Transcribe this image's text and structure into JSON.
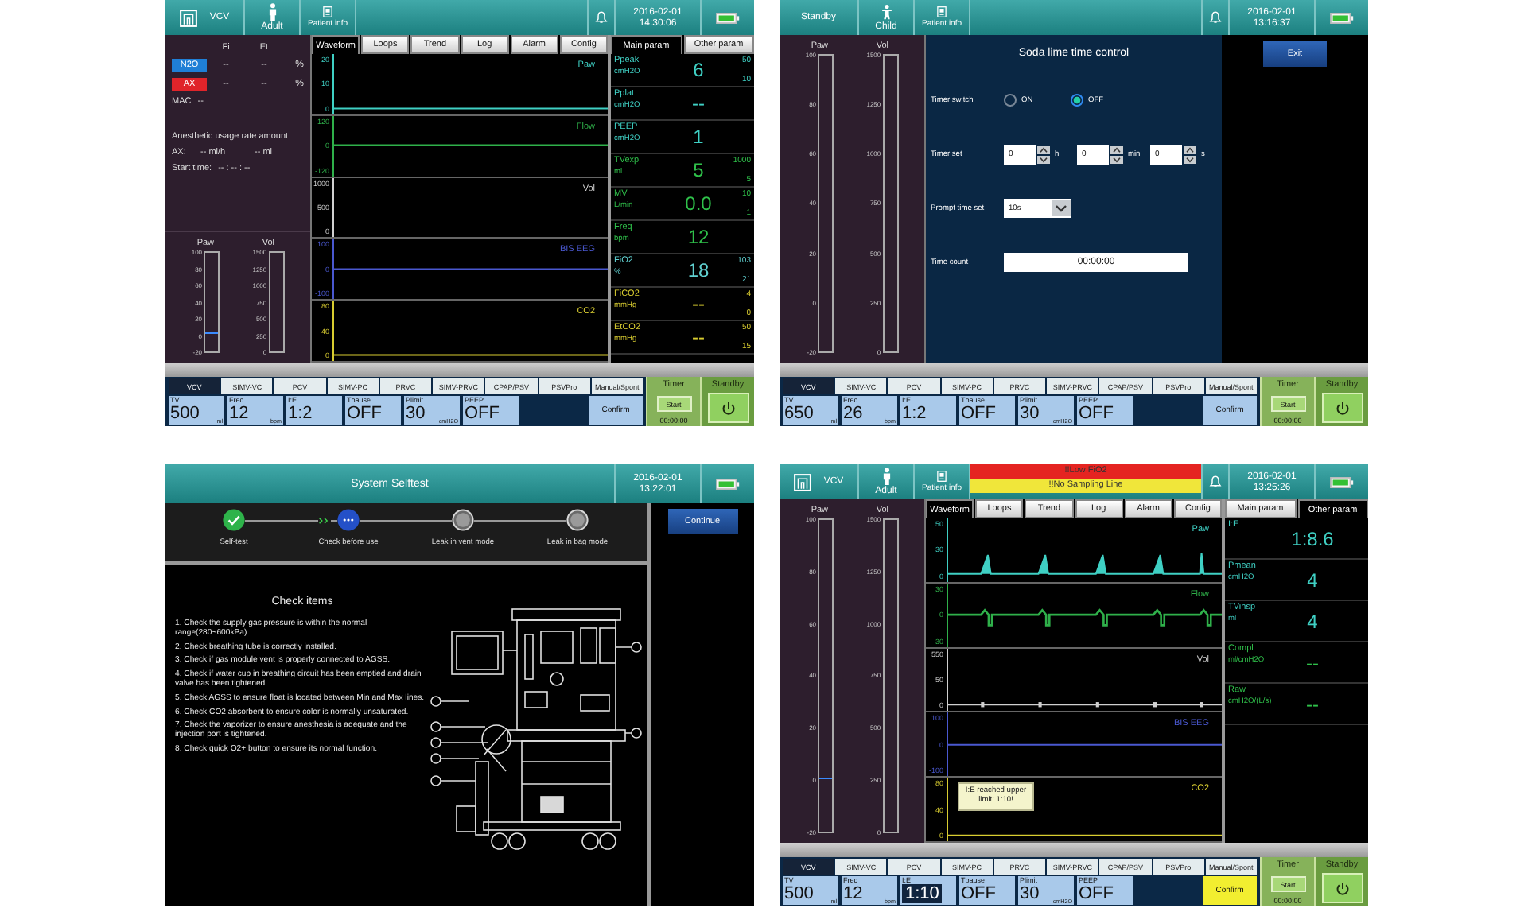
{
  "panels": [
    {
      "kind": "monitor",
      "header": {
        "mode": "VCV",
        "mode_icon": true,
        "patient": {
          "label": "Adult",
          "kind": "adult"
        },
        "patient_info": "Patient info",
        "date": "2016-02-01",
        "time": "14:30:06"
      },
      "gas": {
        "columns": [
          "Fi",
          "Et"
        ],
        "agents": [
          {
            "name": "N2O",
            "color": "#1f7fd6",
            "fi": "--",
            "et": "--",
            "unit": "%"
          },
          {
            "name": "AX",
            "color": "#e0242a",
            "fi": "--",
            "et": "--",
            "unit": "%"
          }
        ],
        "mac": {
          "label": "MAC",
          "value": "--"
        },
        "usage_title": "Anesthetic usage rate amount",
        "usage": {
          "agent": "AX:",
          "rate": "-- ml/h",
          "amount": "-- ml"
        },
        "start_time": {
          "label": "Start time:",
          "value": "-- : -- : --"
        }
      },
      "gauges": [
        {
          "label": "Paw",
          "ticks": [
            "100",
            "80",
            "60",
            "40",
            "20",
            "0",
            "-20"
          ],
          "level": 0.17
        },
        {
          "label": "Vol",
          "ticks": [
            "1500",
            "1250",
            "1000",
            "750",
            "500",
            "250",
            "0"
          ]
        }
      ],
      "wave_tabs": [
        {
          "label": "Waveform",
          "selected": true
        },
        {
          "label": "Loops",
          "selected": false
        },
        {
          "label": "Trend",
          "selected": false
        },
        {
          "label": "Log",
          "selected": false
        },
        {
          "label": "Alarm",
          "selected": false
        },
        {
          "label": "Config",
          "selected": false
        }
      ],
      "waves": [
        {
          "label": "Paw",
          "color": "#3fd0c4",
          "ticks": [
            "20",
            "10",
            "0"
          ],
          "kind": "flat_low"
        },
        {
          "label": "Flow",
          "color": "#2fb04a",
          "ticks": [
            "120",
            "0",
            "-120"
          ],
          "kind": "flat_mid"
        },
        {
          "label": "Vol",
          "color": "#d0d0d0",
          "ticks": [
            "1000",
            "500",
            "0"
          ],
          "kind": "none"
        },
        {
          "label": "BIS EEG",
          "color": "#4a58d0",
          "ticks": [
            "100",
            "0",
            "-100"
          ],
          "kind": "flat_mid"
        },
        {
          "label": "CO2",
          "color": "#d8cc30",
          "ticks": [
            "80",
            "40",
            "0"
          ],
          "kind": "flat_low"
        }
      ],
      "param_tabs": [
        {
          "label": "Main param",
          "selected": true
        },
        {
          "label": "Other param",
          "selected": false
        }
      ],
      "params": [
        {
          "name": "Ppeak",
          "unit": "cmH2O",
          "value": "6",
          "high": "50",
          "low": "10",
          "color": "#3fd0c4"
        },
        {
          "name": "Pplat",
          "unit": "cmH2O",
          "value": "--",
          "color": "#3fd0c4"
        },
        {
          "name": "PEEP",
          "unit": "cmH2O",
          "value": "1",
          "color": "#3fd0c4"
        },
        {
          "name": "TVexp",
          "unit": "ml",
          "value": "5",
          "high": "1000",
          "low": "5",
          "color": "#2fc04a"
        },
        {
          "name": "MV",
          "unit": "L/min",
          "value": "0.0",
          "high": "10",
          "low": "1",
          "color": "#2fc04a"
        },
        {
          "name": "Freq",
          "unit": "bpm",
          "value": "12",
          "color": "#2fc04a"
        },
        {
          "name": "FiO2",
          "unit": "%",
          "value": "18",
          "high": "103",
          "low": "21",
          "color": "#60d0d0"
        },
        {
          "name": "FiCO2",
          "unit": "mmHg",
          "value": "--",
          "high": "4",
          "low": "0",
          "color": "#d8cc30"
        },
        {
          "name": "EtCO2",
          "unit": "mmHg",
          "value": "--",
          "high": "50",
          "low": "15",
          "color": "#d8cc30"
        }
      ],
      "modes": [
        {
          "label": "VCV",
          "selected": true
        },
        {
          "label": "SIMV-VC",
          "selected": false
        },
        {
          "label": "PCV",
          "selected": false
        },
        {
          "label": "SIMV-PC",
          "selected": false
        },
        {
          "label": "PRVC",
          "selected": false
        },
        {
          "label": "SIMV-PRVC",
          "selected": false
        },
        {
          "label": "CPAP/PSV",
          "selected": false
        },
        {
          "label": "PSVPro",
          "selected": false
        },
        {
          "label": "Manual/Spont",
          "selected": false
        }
      ],
      "settings": [
        {
          "label": "TV",
          "value": "500",
          "unit": "ml",
          "selected": false
        },
        {
          "label": "Freq",
          "value": "12",
          "unit": "bpm",
          "selected": false
        },
        {
          "label": "I:E",
          "value": "1:2",
          "selected": false
        },
        {
          "label": "Tpause",
          "value": "OFF",
          "selected": false
        },
        {
          "label": "Plimit",
          "value": "30",
          "unit": "cmH2O",
          "selected": false
        },
        {
          "label": "PEEP",
          "value": "OFF",
          "selected": false
        }
      ],
      "confirm": {
        "label": "Confirm",
        "highlighted": false
      },
      "timer": {
        "title": "Timer",
        "button": "Start",
        "time": "00:00:00"
      },
      "standby": {
        "title": "Standby"
      }
    },
    {
      "kind": "soda_lime",
      "header": {
        "mode": "Standby",
        "mode_icon": false,
        "patient": {
          "label": "Child",
          "kind": "child"
        },
        "patient_info": "Patient info",
        "date": "2016-02-01",
        "time": "13:16:37"
      },
      "gauges": [
        {
          "label": "Paw",
          "ticks": [
            "100",
            "80",
            "60",
            "40",
            "20",
            "0",
            "-20"
          ]
        },
        {
          "label": "Vol",
          "ticks": [
            "1500",
            "1250",
            "1000",
            "750",
            "500",
            "250",
            "0"
          ]
        }
      ],
      "form": {
        "title": "Soda lime time control",
        "switch_label": "Timer switch",
        "switch_options": [
          {
            "label": "ON",
            "selected": false
          },
          {
            "label": "OFF",
            "selected": true
          }
        ],
        "timer_label": "Timer set",
        "timer_fields": [
          {
            "value": "0",
            "unit": "h"
          },
          {
            "value": "0",
            "unit": "min"
          },
          {
            "value": "0",
            "unit": "s"
          }
        ],
        "prompt_label": "Prompt time set",
        "prompt_value": "10s",
        "count_label": "Time count",
        "count_value": "00:00:00"
      },
      "exit": "Exit",
      "modes": [
        {
          "label": "VCV",
          "selected": true
        },
        {
          "label": "SIMV-VC",
          "selected": false
        },
        {
          "label": "PCV",
          "selected": false
        },
        {
          "label": "SIMV-PC",
          "selected": false
        },
        {
          "label": "PRVC",
          "selected": false
        },
        {
          "label": "SIMV-PRVC",
          "selected": false
        },
        {
          "label": "CPAP/PSV",
          "selected": false
        },
        {
          "label": "PSVPro",
          "selected": false
        },
        {
          "label": "Manual/Spont",
          "selected": false
        }
      ],
      "settings": [
        {
          "label": "TV",
          "value": "650",
          "unit": "ml",
          "selected": false
        },
        {
          "label": "Freq",
          "value": "26",
          "unit": "bpm",
          "selected": false
        },
        {
          "label": "I:E",
          "value": "1:2",
          "selected": false
        },
        {
          "label": "Tpause",
          "value": "OFF",
          "selected": false
        },
        {
          "label": "Plimit",
          "value": "30",
          "unit": "cmH2O",
          "selected": false
        },
        {
          "label": "PEEP",
          "value": "OFF",
          "selected": false
        }
      ],
      "confirm": {
        "label": "Confirm",
        "highlighted": false
      },
      "timer": {
        "title": "Timer",
        "button": "Start",
        "time": "00:00:00"
      },
      "standby": {
        "title": "Standby"
      }
    },
    {
      "kind": "selftest",
      "header": {
        "title": "System Selftest",
        "date": "2016-02-01",
        "time": "13:22:01"
      },
      "steps": [
        {
          "label": "Self-test",
          "kind": "done"
        },
        {
          "label": "Check before use",
          "kind": "current"
        },
        {
          "label": "Leak in vent mode",
          "kind": "pending"
        },
        {
          "label": "Leak in bag mode",
          "kind": "pending"
        }
      ],
      "continue": "Continue",
      "checklist_title": "Check items",
      "checklist": [
        "1. Check the supply gas pressure is within the normal range(280~600kPa).",
        "2. Check breathing tube is correctly installed.",
        "3. Check if gas module vent is properly connected to AGSS.",
        "4. Check if water cup in breathing circuit has been emptied and drain valve has been tightened.",
        "5. Check AGSS to ensure float is located between Min and Max lines.",
        "6. Check CO2 absorbent to ensure color is normally unsaturated.",
        "7. Check the vaporizer to ensure anesthesia is adequate and the injection port is tightened.",
        "8. Check quick O2+ button to ensure its normal function."
      ]
    },
    {
      "kind": "monitor",
      "header": {
        "mode": "VCV",
        "mode_icon": true,
        "patient": {
          "label": "Adult",
          "kind": "adult"
        },
        "patient_info": "Patient info",
        "alarms": [
          {
            "text": "!!Low FiO2",
            "color": "#e52421"
          },
          {
            "text": "!!No Sampling Line",
            "color": "#f0e63a"
          }
        ],
        "date": "2016-02-01",
        "time": "13:25:26"
      },
      "gauges": [
        {
          "label": "Paw",
          "ticks": [
            "100",
            "80",
            "60",
            "40",
            "20",
            "0",
            "-20"
          ],
          "level": 0.17
        },
        {
          "label": "Vol",
          "ticks": [
            "1500",
            "1250",
            "1000",
            "750",
            "500",
            "250",
            "0"
          ]
        }
      ],
      "wave_tabs": [
        {
          "label": "Waveform",
          "selected": true
        },
        {
          "label": "Loops",
          "selected": false
        },
        {
          "label": "Trend",
          "selected": false
        },
        {
          "label": "Log",
          "selected": false
        },
        {
          "label": "Alarm",
          "selected": false
        },
        {
          "label": "Config",
          "selected": false
        }
      ],
      "waves": [
        {
          "label": "Paw",
          "color": "#3fd0c4",
          "ticks": [
            "50",
            "30",
            "0"
          ],
          "kind": "spikes"
        },
        {
          "label": "Flow",
          "color": "#2fb04a",
          "ticks": [
            "30",
            "0",
            "-30"
          ],
          "kind": "biphasic"
        },
        {
          "label": "Vol",
          "color": "#d0d0d0",
          "ticks": [
            "550",
            "50",
            "0"
          ],
          "kind": "dots_low"
        },
        {
          "label": "BIS EEG",
          "color": "#4a58d0",
          "ticks": [
            "100",
            "0",
            "-100"
          ],
          "kind": "flat_mid"
        },
        {
          "label": "CO2",
          "color": "#d8cc30",
          "ticks": [
            "80",
            "40",
            "0"
          ],
          "kind": "flat_low"
        }
      ],
      "param_tabs": [
        {
          "label": "Main param",
          "selected": false
        },
        {
          "label": "Other param",
          "selected": true
        }
      ],
      "params": [
        {
          "name": "I:E",
          "value": "1:8.6",
          "color": "#3fd0c4"
        },
        {
          "name": "Pmean",
          "unit": "cmH2O",
          "value": "4",
          "color": "#3fd0c4"
        },
        {
          "name": "TVinsp",
          "unit": "ml",
          "value": "4",
          "color": "#3fd0c4"
        },
        {
          "name": "Compl",
          "unit": "ml/cmH2O",
          "value": "--",
          "color": "#2fc04a"
        },
        {
          "name": "Raw",
          "unit": "cmH2O/(L/s)",
          "value": "--",
          "color": "#2fc04a"
        }
      ],
      "modes": [
        {
          "label": "VCV",
          "selected": true
        },
        {
          "label": "SIMV-VC",
          "selected": false
        },
        {
          "label": "PCV",
          "selected": false
        },
        {
          "label": "SIMV-PC",
          "selected": false
        },
        {
          "label": "PRVC",
          "selected": false
        },
        {
          "label": "SIMV-PRVC",
          "selected": false
        },
        {
          "label": "CPAP/PSV",
          "selected": false
        },
        {
          "label": "PSVPro",
          "selected": false
        },
        {
          "label": "Manual/Spont",
          "selected": false
        }
      ],
      "settings": [
        {
          "label": "TV",
          "value": "500",
          "unit": "ml",
          "selected": false
        },
        {
          "label": "Freq",
          "value": "12",
          "unit": "bpm",
          "selected": false
        },
        {
          "label": "I:E",
          "value": "1:10",
          "selected": true
        },
        {
          "label": "Tpause",
          "value": "OFF",
          "selected": false
        },
        {
          "label": "Plimit",
          "value": "30",
          "unit": "cmH2O",
          "selected": false
        },
        {
          "label": "PEEP",
          "value": "OFF",
          "selected": false
        }
      ],
      "tooltip": "I:E reached upper limit: 1:10!",
      "confirm": {
        "label": "Confirm",
        "highlighted": true
      },
      "timer": {
        "title": "Timer",
        "button": "Start",
        "time": "00:00:00"
      },
      "standby": {
        "title": "Standby"
      }
    }
  ]
}
